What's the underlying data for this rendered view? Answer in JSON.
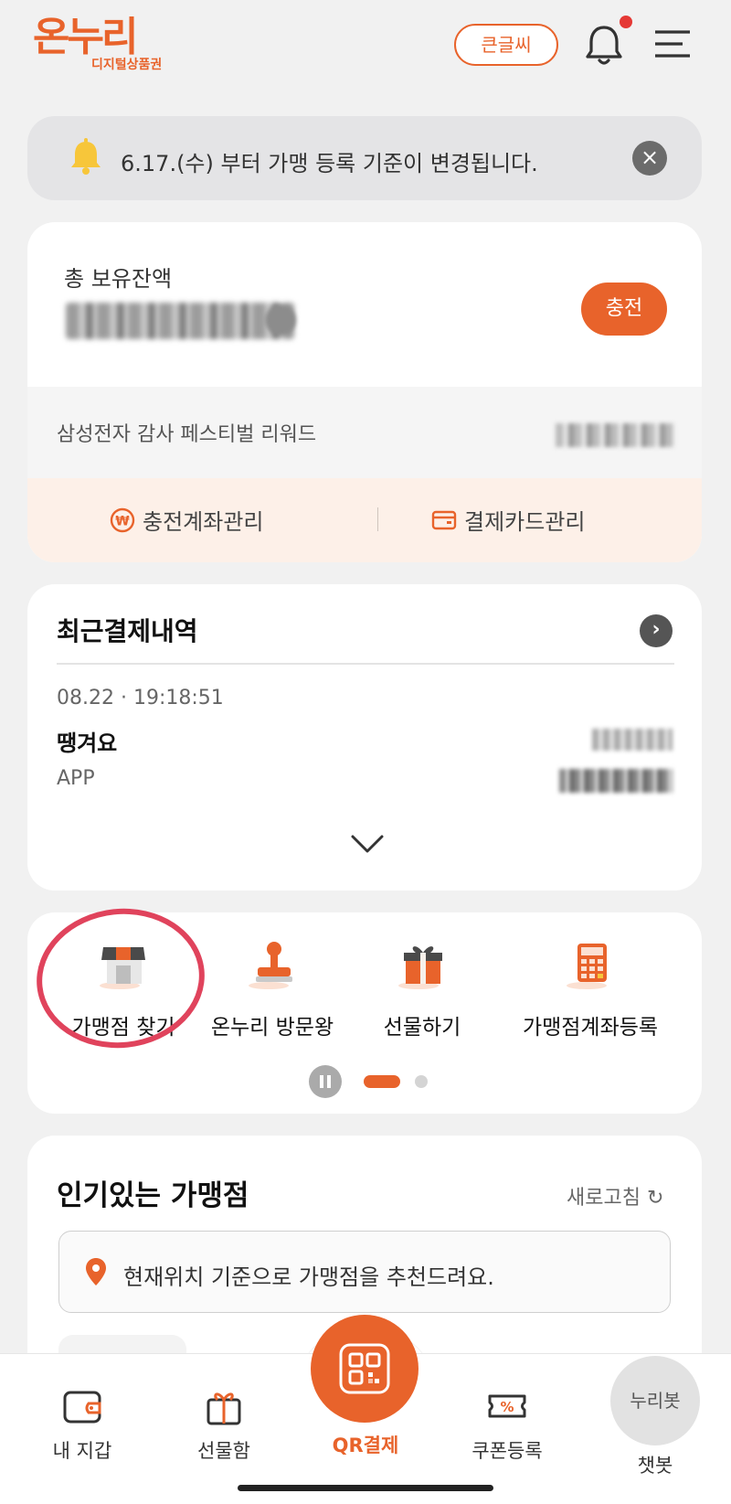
{
  "header": {
    "logo_main": "온누리",
    "logo_sub": "디지털상품권",
    "big_font_label": "큰글씨",
    "bell_icon": "bell-icon",
    "menu_icon": "hamburger-menu-icon"
  },
  "notice": {
    "icon": "bell-icon",
    "text": "6.17.(수) 부터 가맹 등록 기준이 변경됩니다.",
    "close_symbol": "×"
  },
  "balance": {
    "label": "총 보유잔액",
    "charge_label": "충전",
    "reward_label": "삼성전자 감사 페스티벌 리워드",
    "manage_account_label": "충전계좌관리",
    "manage_card_label": "결제카드관리"
  },
  "recent": {
    "title": "최근결제내역",
    "go_symbol": "›",
    "time": "08.22 · 19:18:51",
    "store": "땡겨요",
    "method": "APP"
  },
  "quick_menu": {
    "items": [
      {
        "label": "가맹점 찾기",
        "icon": "store-icon"
      },
      {
        "label": "온누리 방문왕",
        "icon": "stamp-icon"
      },
      {
        "label": "선물하기",
        "icon": "gift-icon"
      },
      {
        "label": "가맹점계좌등록",
        "icon": "calculator-icon"
      }
    ]
  },
  "popular": {
    "title": "인기있는 가맹점",
    "refresh_label": "새로고침 ↻",
    "location_text": "현재위치 기준으로 가맹점을 추천드려요."
  },
  "bottom_nav": {
    "wallet_label": "내 지갑",
    "giftbox_label": "선물함",
    "qr_label": "QR결제",
    "coupon_label": "쿠폰등록",
    "chatbot_circle": "누리봇",
    "chatbot_label": "챗봇"
  },
  "colors": {
    "accent": "#e8632b",
    "background": "#f1f1f1",
    "annotation_circle": "#e0435c"
  }
}
